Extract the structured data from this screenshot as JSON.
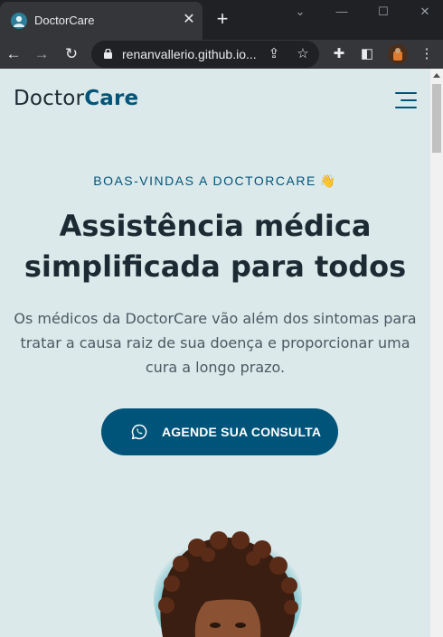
{
  "browser": {
    "tab_title": "DoctorCare",
    "url": "renanvallerio.github.io...",
    "icons": {
      "close": "close-icon",
      "new_tab": "plus-icon",
      "back": "arrow-left-icon",
      "forward": "arrow-right-icon",
      "reload": "reload-icon",
      "share": "share-icon",
      "bookmark": "star-icon",
      "extensions": "puzzle-icon",
      "sidepanel": "side-panel-icon",
      "menu": "kebab-menu-icon"
    }
  },
  "page": {
    "logo_part1": "Doctor",
    "logo_part2": "Care",
    "kicker": "BOAS-VINDAS A DOCTORCARE",
    "kicker_emoji": "👋",
    "headline": "Assistência médica simplificada para todos",
    "subtext": "Os médicos da DoctorCare vão além dos sintomas para tratar a causa raiz de sua doença e proporcionar uma cura a longo prazo.",
    "cta_label": "AGENDE SUA CONSULTA"
  },
  "colors": {
    "page_bg": "#dce9ea",
    "brand": "#00547a",
    "text_dark": "#1c2b33",
    "text_body": "#4a5a63"
  }
}
